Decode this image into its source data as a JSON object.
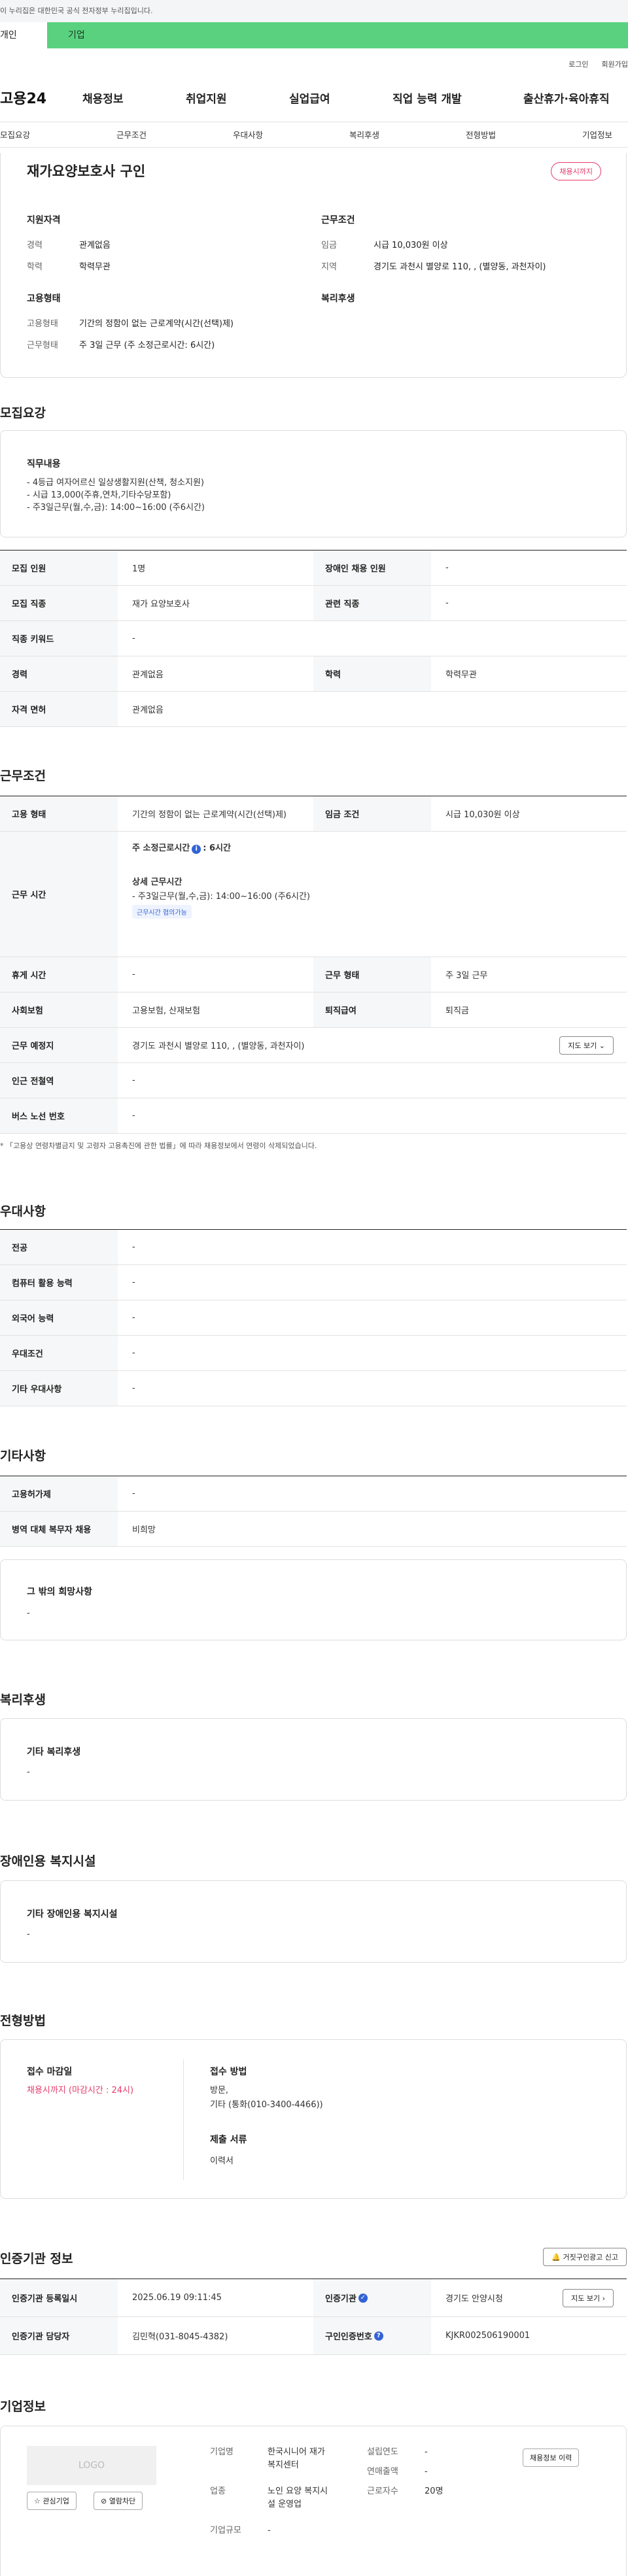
{
  "gov_bar": "이 누리집은 대한민국 공식 전자정부 누리집입니다.",
  "gnb_tabs": {
    "personal": "개인",
    "company": "기업"
  },
  "util": {
    "login": "로그인",
    "signup": "회원가입"
  },
  "logo": "고용24",
  "main_menu": [
    "채용정보",
    "취업지원",
    "실업급여",
    "직업 능력 개발",
    "출산휴가·육아휴직"
  ],
  "anchor_nav": [
    "모집요강",
    "근무조건",
    "우대사항",
    "복리후생",
    "전형방법",
    "기업정보"
  ],
  "job": {
    "title": "재가요양보호사 구인",
    "status": "채용시까지"
  },
  "summary": {
    "qual_title": "지원자격",
    "work_title": "근무조건",
    "employ_title": "고용형태",
    "welfare_title": "복리후생",
    "qual": [
      {
        "k": "경력",
        "v": "관계없음"
      },
      {
        "k": "학력",
        "v": "학력무관"
      }
    ],
    "work": [
      {
        "k": "임금",
        "v": "시급 10,030원 이상"
      },
      {
        "k": "지역",
        "v": "경기도 과천시 별양로 110, , (별양동, 과천자이)"
      }
    ],
    "employ": [
      {
        "k": "고용형태",
        "v": "기간의 정함이 없는 근로계약(시간(선택)제)"
      },
      {
        "k": "근무형태",
        "v": "주 3일 근무 (주 소정근로시간: 6시간)"
      }
    ]
  },
  "recruit": {
    "section": "모집요강",
    "duty_label": "직무내용",
    "duty_lines": [
      "- 4등급 여자어르신 일상생활지원(산책, 청소지원)",
      "- 시급 13,000(주휴,연차,기타수당포함)",
      "- 주3일근무(월,수,금): 14:00~16:00 (주6시간)"
    ],
    "rows": [
      {
        "k1": "모집 인원",
        "v1": "1명",
        "k2": "장애인 채용 인원",
        "v2": "-"
      },
      {
        "k1": "모집 직종",
        "v1": "재가 요양보호사",
        "k2": "관련 직종",
        "v2": "-"
      },
      {
        "k1": "직종 키워드",
        "v1": "-"
      },
      {
        "k1": "경력",
        "v1": "관계없음",
        "k2": "학력",
        "v2": "학력무관"
      },
      {
        "k1": "자격 면허",
        "v1": "관계없음"
      }
    ]
  },
  "conditions": {
    "section": "근무조건",
    "employ": {
      "k1": "고용 형태",
      "v1": "기간의 정함이 없는 근로계약(시간(선택)제)",
      "k2": "임금 조건",
      "v2": "시급 10,030원 이상"
    },
    "hours": {
      "k": "근무 시간",
      "weekly_label": "주 소정근로시간",
      "weekly_info": "i",
      "weekly_value": ": 6시간",
      "detail_label": "상세 근무시간",
      "detail_value": "- 주3일근무(월,수,금): 14:00~16:00 (주6시간)",
      "pill": "근무시간 협의가능"
    },
    "rows": [
      {
        "k1": "휴게 시간",
        "v1": "-",
        "k2": "근무 형태",
        "v2": "주 3일 근무"
      },
      {
        "k1": "사회보험",
        "v1": "고용보험, 산재보험",
        "k2": "퇴직급여",
        "v2": "퇴직금"
      }
    ],
    "place": {
      "k": "근무 예정지",
      "v": "경기도 과천시 별양로 110, , (별양동, 과천자이)",
      "btn": "지도 보기"
    },
    "rows2": [
      {
        "k": "인근 전철역",
        "v": "-"
      },
      {
        "k": "버스 노선 번호",
        "v": "-"
      }
    ],
    "note": "* 「고용상 연령차별금지 및 고령자 고용촉진에 관한 법률」에 따라 채용정보에서 연령이 삭제되었습니다."
  },
  "prefer": {
    "section": "우대사항",
    "rows": [
      {
        "k": "전공",
        "v": "-"
      },
      {
        "k": "컴퓨터 활용 능력",
        "v": "-"
      },
      {
        "k": "외국어 능력",
        "v": "-"
      },
      {
        "k": "우대조건",
        "v": "-"
      },
      {
        "k": "기타 우대사항",
        "v": "-"
      }
    ]
  },
  "etc": {
    "section": "기타사항",
    "rows": [
      {
        "k": "고용허가제",
        "v": "-"
      },
      {
        "k": "병역 대체 복무자 채용",
        "v": "비희망"
      }
    ],
    "other_label": "그 밖의 희망사항",
    "other_value": "-"
  },
  "welfare": {
    "section": "복리후생",
    "label": "기타 복리후생",
    "value": "-"
  },
  "disabled": {
    "section": "장애인용 복지시설",
    "label": "기타 장애인용 복지시설",
    "value": "-"
  },
  "selection": {
    "section": "전형방법",
    "deadline_label": "접수 마감일",
    "deadline_value": "채용시까지 (마감시간 : 24시)",
    "method_label": "접수 방법",
    "method_value1": "방문,",
    "method_value2": "기타 (통화(010-3400-4466))",
    "docs_label": "제출 서류",
    "docs_value": "이력서"
  },
  "cert": {
    "section": "인증기관 정보",
    "report_btn": "거짓구인광고 신고",
    "rows": [
      {
        "k1": "인증기관 등록일시",
        "v1": "2025.06.19 09:11:45",
        "k2": "인증기관",
        "v2": "경기도 안양시청",
        "btn": "지도 보기"
      },
      {
        "k1": "인증기관 담당자",
        "v1": "김민혁(031-8045-4382)",
        "k2": "구인인증번호",
        "v2": "KJKR002506190001"
      }
    ]
  },
  "company": {
    "section": "기업정보",
    "logo": "LOGO",
    "fav_btn": "관심기업",
    "block_btn": "열람차단",
    "history_btn": "채용정보 이력",
    "name_k": "기업명",
    "name_v1": "한국시니어 재가",
    "name_v2": "복지센터",
    "industry_k": "업종",
    "industry_v1": "노인 요양 복지시",
    "industry_v2": "설 운영업",
    "size_k": "기업규모",
    "size_v": "-",
    "founded_k": "설립연도",
    "founded_v": "-",
    "sales_k": "연매출액",
    "sales_v": "-",
    "staff_k": "근로자수",
    "staff_v": "20명"
  }
}
